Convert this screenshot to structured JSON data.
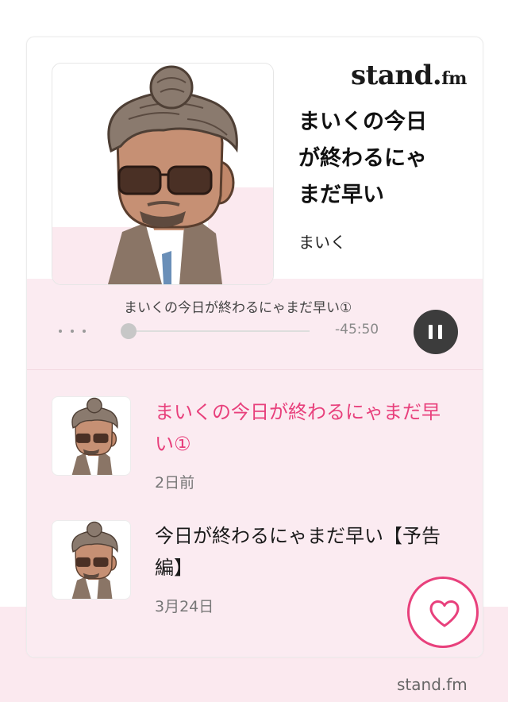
{
  "brand": {
    "logo_main": "stand.",
    "logo_suffix": "fm",
    "footer_link": "stand.fm"
  },
  "channel": {
    "title": "まいくの今日が終わるにゃまだ早い",
    "title_lines": [
      "まいくの今日",
      "が終わるにゃ",
      "まだ早い"
    ],
    "author": "まいく"
  },
  "player": {
    "now_playing": "まいくの今日が終わるにゃまだ早い①",
    "remaining_time": "-45:50",
    "progress_fraction": 0.0
  },
  "episodes": [
    {
      "title": "まいくの今日が終わるにゃまだ早い①",
      "date": "2日前",
      "active": true
    },
    {
      "title": "今日が終わるにゃまだ早い【予告編】",
      "date": "3月24日",
      "active": false
    }
  ],
  "colors": {
    "accent": "#e8407c",
    "pink_bg": "#fbebf1",
    "pause_button": "#3c3c3c"
  },
  "icons": {
    "more": "more-dots-icon",
    "pause": "pause-icon",
    "like": "heart-icon"
  }
}
